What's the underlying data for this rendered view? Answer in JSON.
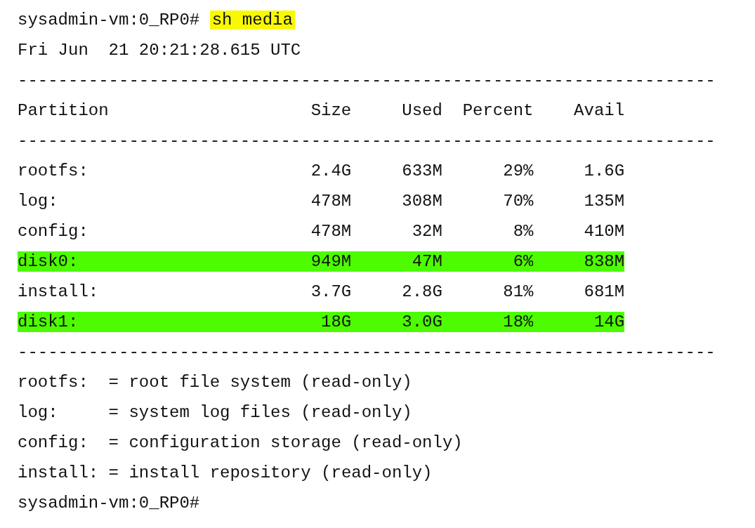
{
  "prompt": "sysadmin-vm:0_RP0#",
  "command": {
    "text": "sh media",
    "highlighted": true
  },
  "timestamp": "Fri Jun  21 20:21:28.615 UTC",
  "rule_top": "---------------------------------------------------------------------",
  "columns": [
    "Partition",
    "Size",
    "Used",
    "Percent",
    "Avail"
  ],
  "rule_header": "---------------------------------------------------------------------",
  "rows": [
    {
      "cells": [
        "rootfs:",
        "2.4G",
        "633M",
        "29%",
        "1.6G"
      ],
      "highlighted": false
    },
    {
      "cells": [
        "log:",
        "478M",
        "308M",
        "70%",
        "135M"
      ],
      "highlighted": false
    },
    {
      "cells": [
        "config:",
        "478M",
        "32M",
        "8%",
        "410M"
      ],
      "highlighted": false
    },
    {
      "cells": [
        "disk0:",
        "949M",
        "47M",
        "6%",
        "838M"
      ],
      "highlighted": true
    },
    {
      "cells": [
        "install:",
        "3.7G",
        "2.8G",
        "81%",
        "681M"
      ],
      "highlighted": false
    },
    {
      "cells": [
        "disk1:",
        "18G",
        "3.0G",
        "18%",
        "14G"
      ],
      "highlighted": true
    }
  ],
  "rule_bottom": "---------------------------------------------------------------------",
  "legend": [
    "rootfs:  = root file system (read-only)",
    "log:     = system log files (read-only)",
    "config:  = configuration storage (read-only)",
    "install: = install repository (read-only)"
  ],
  "final_prompt": "sysadmin-vm:0_RP0#"
}
